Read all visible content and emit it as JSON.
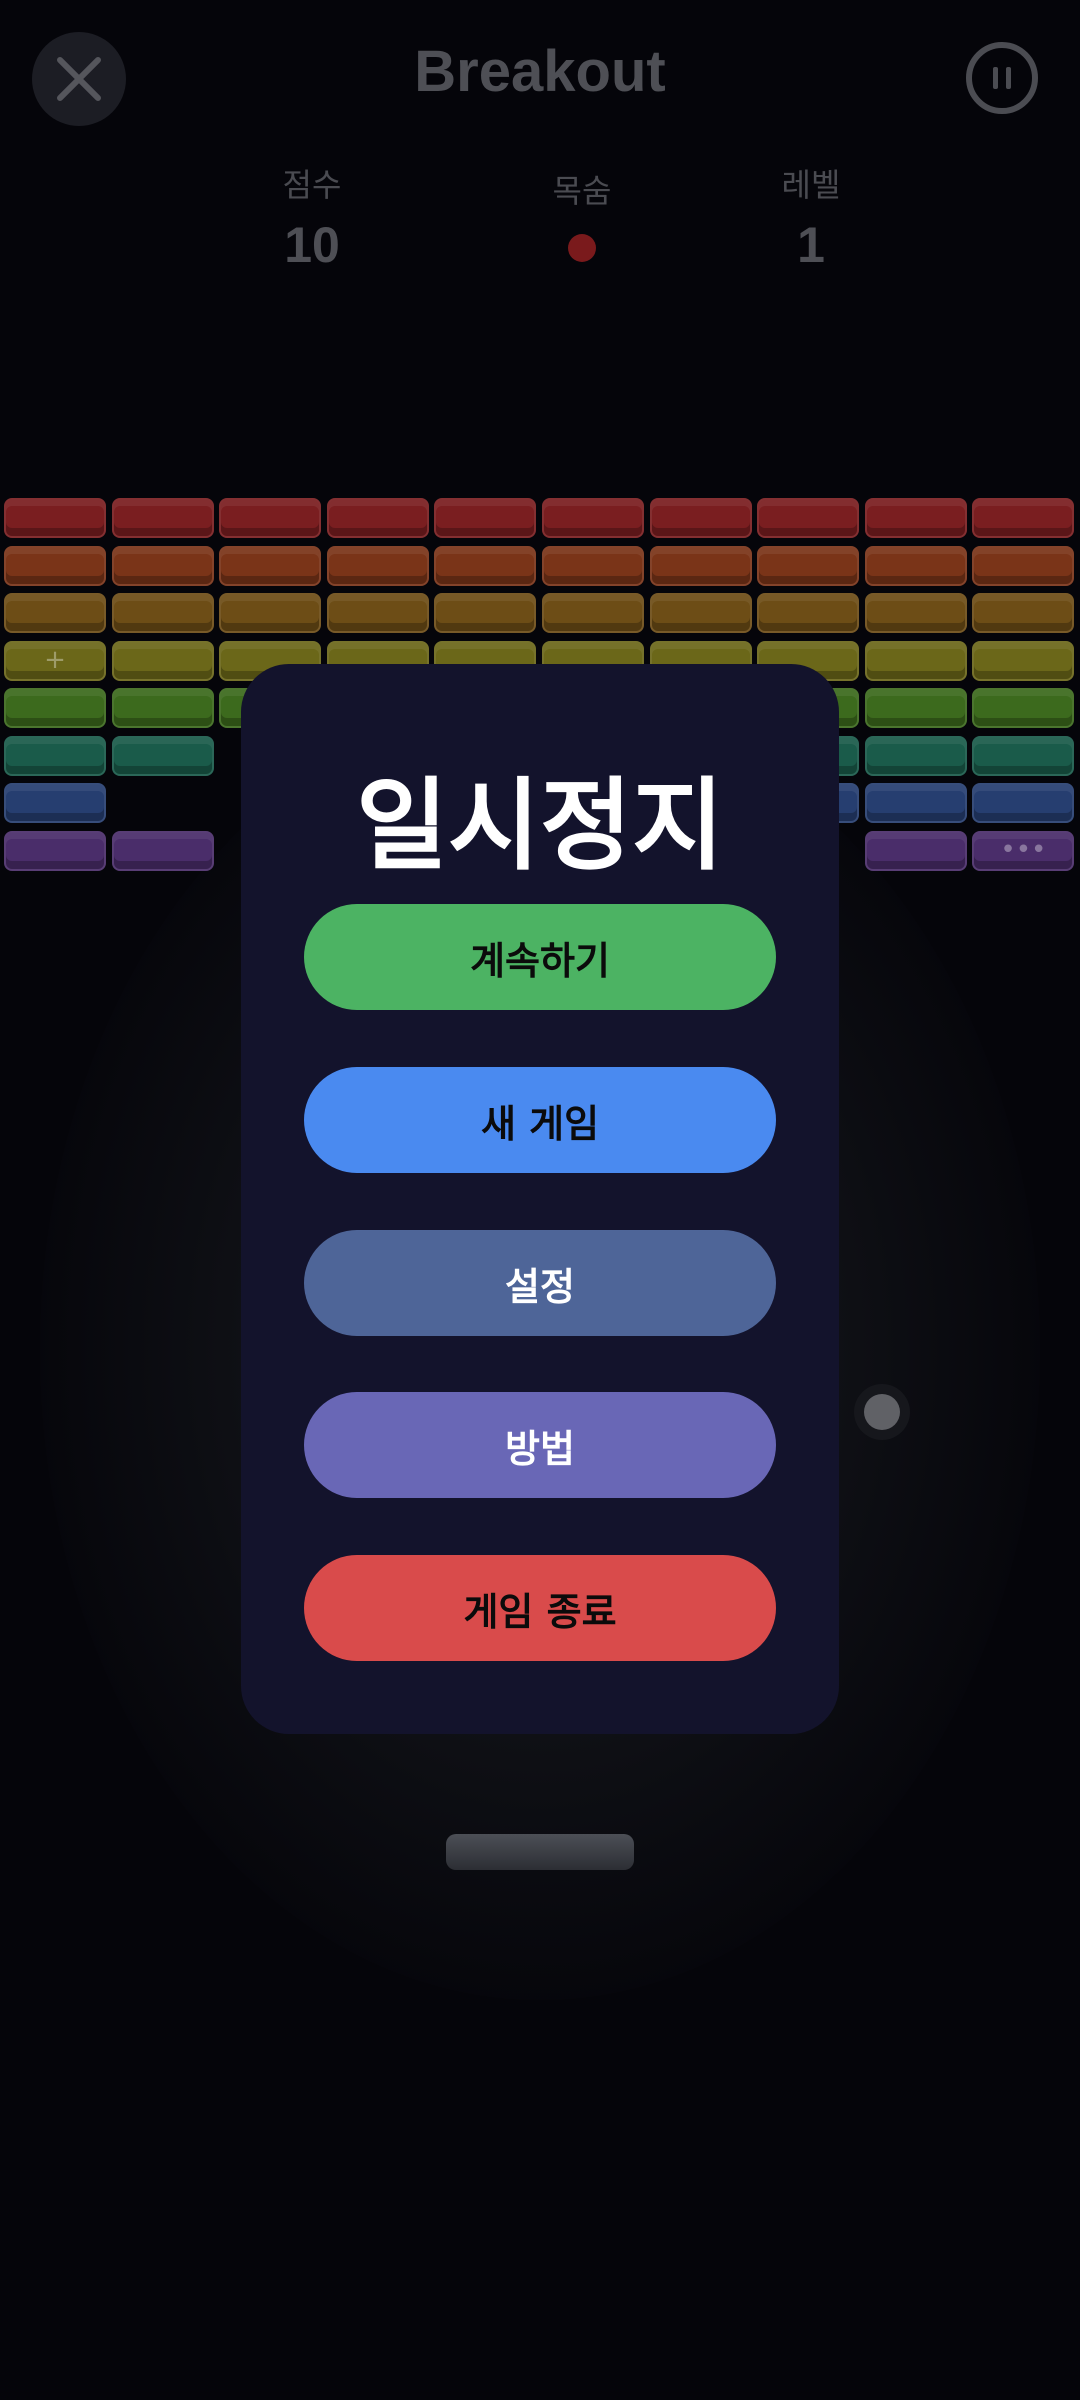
{
  "header": {
    "title": "Breakout",
    "close_icon": "close-icon",
    "pause_icon": "pause-icon"
  },
  "stats": {
    "score_label": "점수",
    "score_value": "10",
    "lives_label": "목숨",
    "lives_count": 1,
    "level_label": "레벨",
    "level_value": "1"
  },
  "bricks": {
    "row_colors": [
      "#7a1e20",
      "#7a3418",
      "#6d4d16",
      "#6b6719",
      "#3c6a1d",
      "#1a5b4a",
      "#263e70",
      "#4a2d6a"
    ],
    "columns": 10,
    "rows": [
      [
        1,
        1,
        1,
        1,
        1,
        1,
        1,
        1,
        1,
        1
      ],
      [
        1,
        1,
        1,
        1,
        1,
        1,
        1,
        1,
        1,
        1
      ],
      [
        1,
        1,
        1,
        1,
        1,
        1,
        1,
        1,
        1,
        1
      ],
      [
        1,
        1,
        1,
        1,
        1,
        1,
        1,
        1,
        1,
        1
      ],
      [
        1,
        1,
        1,
        1,
        1,
        1,
        1,
        1,
        1,
        1
      ],
      [
        1,
        1,
        0,
        0,
        0,
        0,
        0,
        1,
        1,
        1
      ],
      [
        1,
        0,
        0,
        0,
        0,
        0,
        0,
        1,
        1,
        1
      ],
      [
        1,
        1,
        0,
        0,
        0,
        0,
        0,
        0,
        1,
        1
      ]
    ],
    "marks": [
      {
        "row": 3,
        "col": 0,
        "text": "+"
      },
      {
        "row": 7,
        "col": 9,
        "text": "•••"
      }
    ]
  },
  "pause_menu": {
    "title": "일시정지",
    "buttons": [
      {
        "id": "continue",
        "label": "계속하기",
        "color": "#4cb363",
        "text_color": "#0b0b0b"
      },
      {
        "id": "new-game",
        "label": "새 게임",
        "color": "#4a8af0",
        "text_color": "#0b0b0b"
      },
      {
        "id": "settings",
        "label": "설정",
        "color": "#4e6598",
        "text_color": "#ffffff"
      },
      {
        "id": "how-to",
        "label": "방법",
        "color": "#6967b6",
        "text_color": "#ffffff"
      },
      {
        "id": "quit",
        "label": "게임 종료",
        "color": "#d94b4b",
        "text_color": "#0b0b0b"
      }
    ]
  }
}
